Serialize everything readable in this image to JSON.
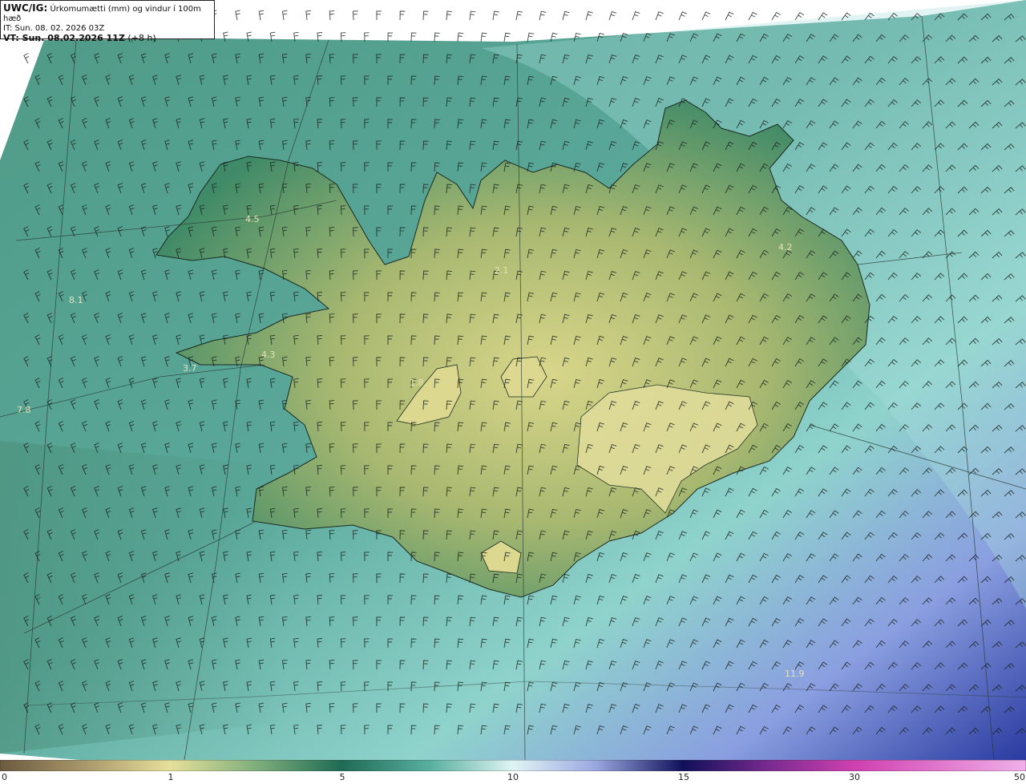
{
  "header": {
    "model": "UWC/IG:",
    "product": " Úrkomumætti (mm) og vindur í 100m hæð",
    "init_time": "IT: Sun. 08. 02. 2026 03Z",
    "valid_prefix": "VT: Sun. 08.02.2026 11Z",
    "lead": " (+8 h)"
  },
  "colorbar": {
    "ticks": [
      "0",
      "1",
      "5",
      "10",
      "15",
      "30",
      "50"
    ],
    "colors": [
      "#6b5a3e",
      "#a7966a",
      "#e6e09a",
      "#3f8f70",
      "#1e6b55",
      "#8fd0c8",
      "#e0f4f4",
      "#9aa8e0",
      "#3a3aa0",
      "#10105a",
      "#7a2a90",
      "#d040b0",
      "#f0b0e8"
    ]
  },
  "values": [
    {
      "label": "4.5",
      "name": "westfjords"
    },
    {
      "label": "8.1",
      "name": "west-sea"
    },
    {
      "label": "4.3",
      "name": "snaefellsnes-north"
    },
    {
      "label": "3.7",
      "name": "snaefellsnes-west"
    },
    {
      "label": "7.8",
      "name": "southwest-sea"
    },
    {
      "label": "2.1",
      "name": "north"
    },
    {
      "label": "1.8",
      "name": "langjokull"
    },
    {
      "label": "4.2",
      "name": "east"
    },
    {
      "label": "11.9",
      "name": "southeast-sea"
    }
  ]
}
